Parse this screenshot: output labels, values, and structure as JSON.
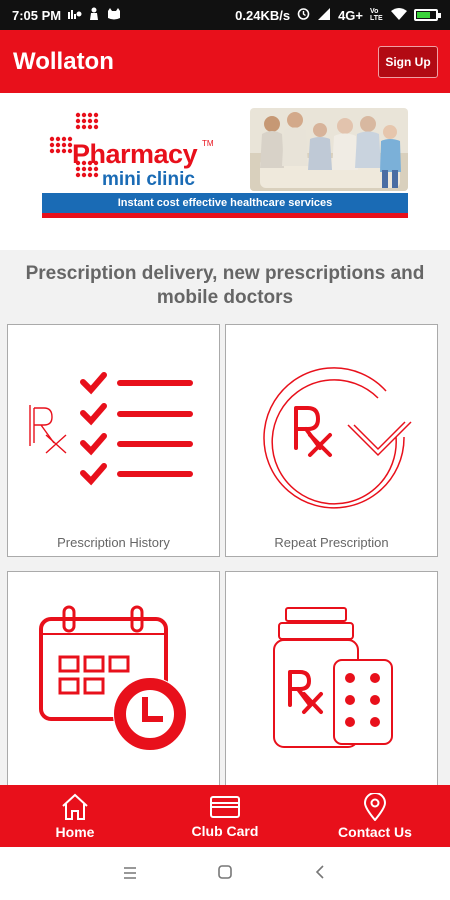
{
  "status": {
    "time": "7:05 PM",
    "speed": "0.24KB/s",
    "network": "4G+",
    "carrier_small": "Vo LTE"
  },
  "header": {
    "title": "Wollaton",
    "signup_label": "Sign Up"
  },
  "banner": {
    "brand": "Pharmacy",
    "tm": "TM",
    "sub": "mini clinic",
    "tagline": "Instant cost effective healthcare services"
  },
  "heading": "Prescription delivery, new prescriptions and mobile doctors",
  "tiles": [
    {
      "label": "Prescription History",
      "icon": "checklist-icon"
    },
    {
      "label": "Repeat Prescription",
      "icon": "refresh-rx-icon"
    },
    {
      "label": "",
      "icon": "calendar-clock-icon"
    },
    {
      "label": "",
      "icon": "medicine-bottle-icon"
    }
  ],
  "bottom_nav": [
    {
      "label": "Home",
      "icon": "home-icon"
    },
    {
      "label": "Club Card",
      "icon": "card-icon"
    },
    {
      "label": "Contact Us",
      "icon": "location-pin-icon"
    }
  ],
  "colors": {
    "brand_red": "#e8101b",
    "brand_blue": "#1a6bb5",
    "text_grey": "#666666"
  }
}
